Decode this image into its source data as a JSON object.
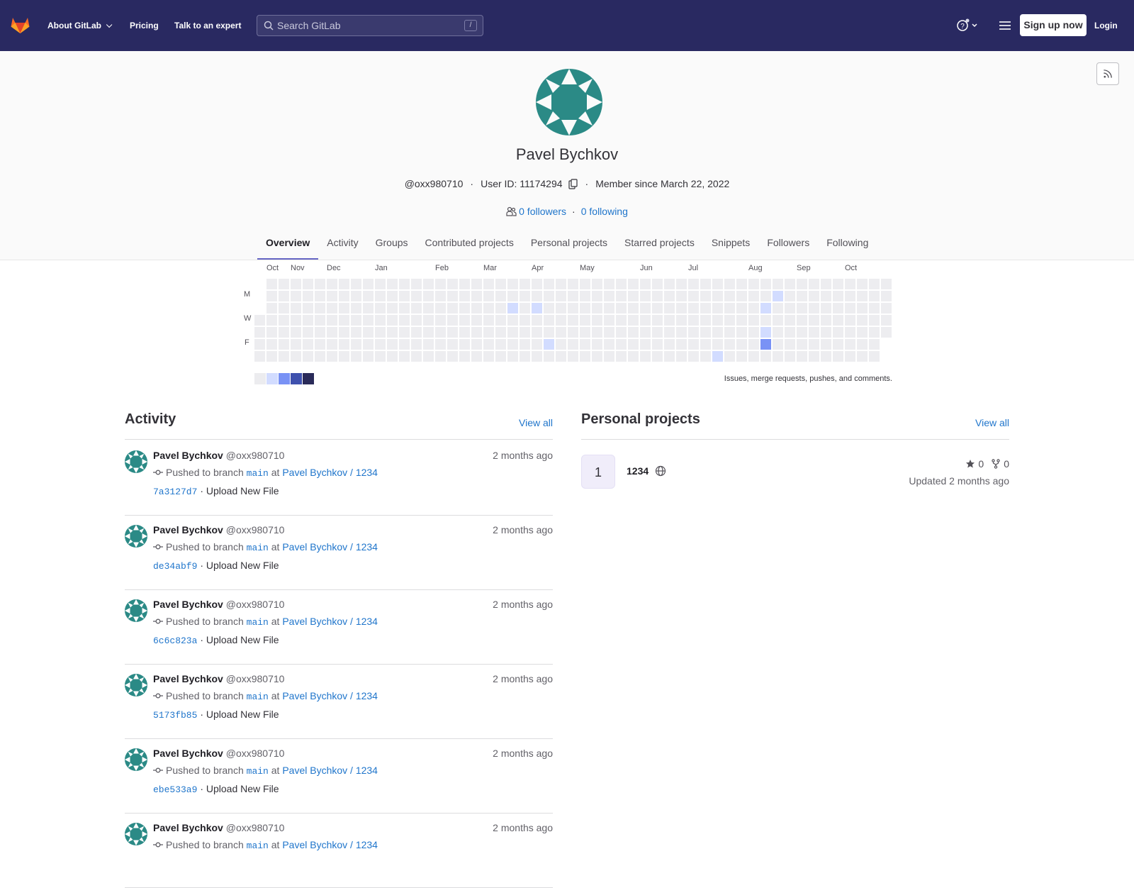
{
  "navbar": {
    "about": "About GitLab",
    "pricing": "Pricing",
    "expert": "Talk to an expert",
    "search_placeholder": "Search GitLab",
    "search_shortcut": "/",
    "signup": "Sign up now",
    "login": "Login",
    "colors": {
      "background": "#292961",
      "logo": "#fc6d26"
    }
  },
  "profile": {
    "name": "Pavel Bychkov",
    "handle": "@oxx980710",
    "user_id": "User ID: 11174294",
    "member_since": "Member since March 22, 2022",
    "followers": "0 followers",
    "following": "0 following",
    "avatar_color": "#2b8a86"
  },
  "tabs": [
    "Overview",
    "Activity",
    "Groups",
    "Contributed projects",
    "Personal projects",
    "Starred projects",
    "Snippets",
    "Followers",
    "Following"
  ],
  "calendar": {
    "months": [
      "Oct",
      "Nov",
      "Dec",
      "Jan",
      "Feb",
      "Mar",
      "Apr",
      "May",
      "Jun",
      "Jul",
      "Aug",
      "Sep",
      "Oct"
    ],
    "days": [
      "M",
      "W",
      "F"
    ],
    "caption": "Issues, merge requests, pushes, and comments.",
    "legend_colors": [
      "#ececef",
      "#d2dcff",
      "#7992f5",
      "#3f51ae",
      "#2a2b59"
    ]
  },
  "activity": {
    "title": "Activity",
    "view_all": "View all",
    "events": [
      {
        "user": "Pavel Bychkov",
        "handle": "@oxx980710",
        "time": "2 months ago",
        "action": "Pushed to branch",
        "branch": "main",
        "at": "at",
        "project": "Pavel Bychkov / 1234",
        "sha": "7a3127d7",
        "message": "· Upload New File"
      },
      {
        "user": "Pavel Bychkov",
        "handle": "@oxx980710",
        "time": "2 months ago",
        "action": "Pushed to branch",
        "branch": "main",
        "at": "at",
        "project": "Pavel Bychkov / 1234",
        "sha": "de34abf9",
        "message": "· Upload New File"
      },
      {
        "user": "Pavel Bychkov",
        "handle": "@oxx980710",
        "time": "2 months ago",
        "action": "Pushed to branch",
        "branch": "main",
        "at": "at",
        "project": "Pavel Bychkov / 1234",
        "sha": "6c6c823a",
        "message": "· Upload New File"
      },
      {
        "user": "Pavel Bychkov",
        "handle": "@oxx980710",
        "time": "2 months ago",
        "action": "Pushed to branch",
        "branch": "main",
        "at": "at",
        "project": "Pavel Bychkov / 1234",
        "sha": "5173fb85",
        "message": "· Upload New File"
      },
      {
        "user": "Pavel Bychkov",
        "handle": "@oxx980710",
        "time": "2 months ago",
        "action": "Pushed to branch",
        "branch": "main",
        "at": "at",
        "project": "Pavel Bychkov / 1234",
        "sha": "ebe533a9",
        "message": "· Upload New File"
      },
      {
        "user": "Pavel Bychkov",
        "handle": "@oxx980710",
        "time": "2 months ago",
        "action": "Pushed to branch",
        "branch": "main",
        "at": "at",
        "project": "Pavel Bychkov / 1234",
        "sha": "",
        "message": ""
      }
    ]
  },
  "projects": {
    "title": "Personal projects",
    "view_all": "View all",
    "items": [
      {
        "avatar_letter": "1",
        "name": "1234",
        "stars": "0",
        "forks": "0",
        "updated": "Updated 2 months ago"
      }
    ]
  }
}
